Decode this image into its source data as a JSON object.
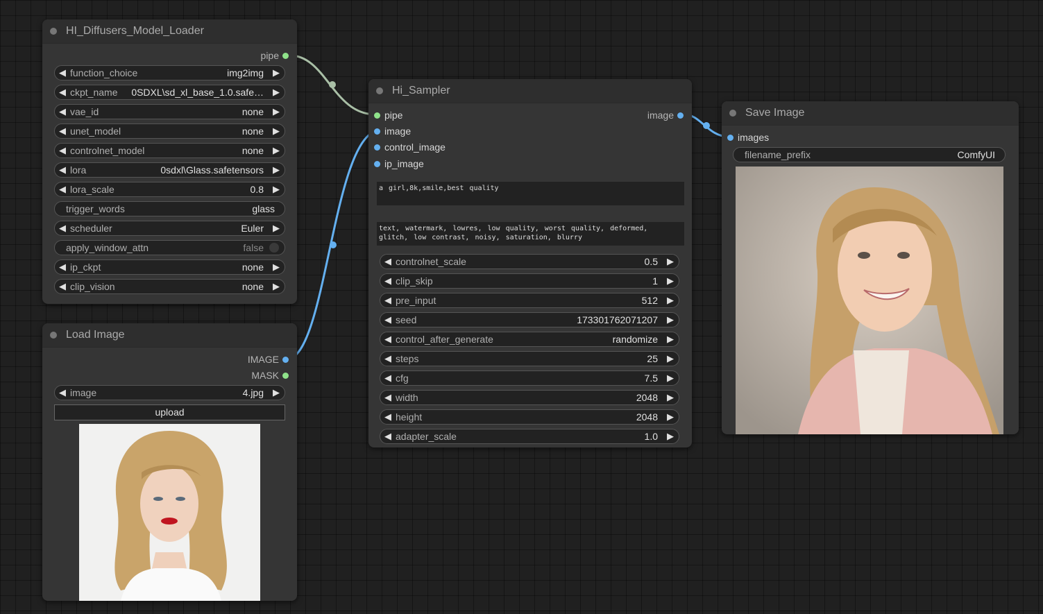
{
  "loader_node": {
    "title": "HI_Diffusers_Model_Loader",
    "output": "pipe",
    "widgets": [
      {
        "label": "function_choice",
        "value": "img2img"
      },
      {
        "label": "ckpt_name",
        "value": "0SDXL\\sd_xl_base_1.0.safe…"
      },
      {
        "label": "vae_id",
        "value": "none"
      },
      {
        "label": "unet_model",
        "value": "none"
      },
      {
        "label": "controlnet_model",
        "value": "none"
      },
      {
        "label": "lora",
        "value": "0sdxl\\Glass.safetensors"
      },
      {
        "label": "lora_scale",
        "value": "0.8"
      },
      {
        "label": "trigger_words",
        "value": "glass"
      },
      {
        "label": "scheduler",
        "value": "Euler"
      },
      {
        "label": "apply_window_attn",
        "value": "false"
      },
      {
        "label": "ip_ckpt",
        "value": "none"
      },
      {
        "label": "clip_vision",
        "value": "none"
      }
    ]
  },
  "load_image_node": {
    "title": "Load Image",
    "outputs": [
      "IMAGE",
      "MASK"
    ],
    "image_widget": {
      "label": "image",
      "value": "4.jpg"
    },
    "upload_label": "upload"
  },
  "sampler_node": {
    "title": "Hi_Sampler",
    "inputs": [
      "pipe",
      "image",
      "control_image",
      "ip_image"
    ],
    "output": "image",
    "positive_prompt": "a girl,8k,smile,best quality",
    "negative_prompt": "text, watermark, lowres, low quality, worst quality, deformed, glitch, low contrast, noisy, saturation, blurry",
    "widgets": [
      {
        "label": "controlnet_scale",
        "value": "0.5"
      },
      {
        "label": "clip_skip",
        "value": "1"
      },
      {
        "label": "pre_input",
        "value": "512"
      },
      {
        "label": "seed",
        "value": "173301762071207"
      },
      {
        "label": "control_after_generate",
        "value": "randomize"
      },
      {
        "label": "steps",
        "value": "25"
      },
      {
        "label": "cfg",
        "value": "7.5"
      },
      {
        "label": "width",
        "value": "2048"
      },
      {
        "label": "height",
        "value": "2048"
      },
      {
        "label": "adapter_scale",
        "value": "1.0"
      }
    ]
  },
  "save_node": {
    "title": "Save Image",
    "input": "images",
    "filename_prefix": {
      "label": "filename_prefix",
      "value": "ComfyUI"
    }
  },
  "colors": {
    "pipe_wire": "#a9bfa6",
    "image_wire": "#64b0f0",
    "canvas": "#202020",
    "node": "#353535"
  }
}
